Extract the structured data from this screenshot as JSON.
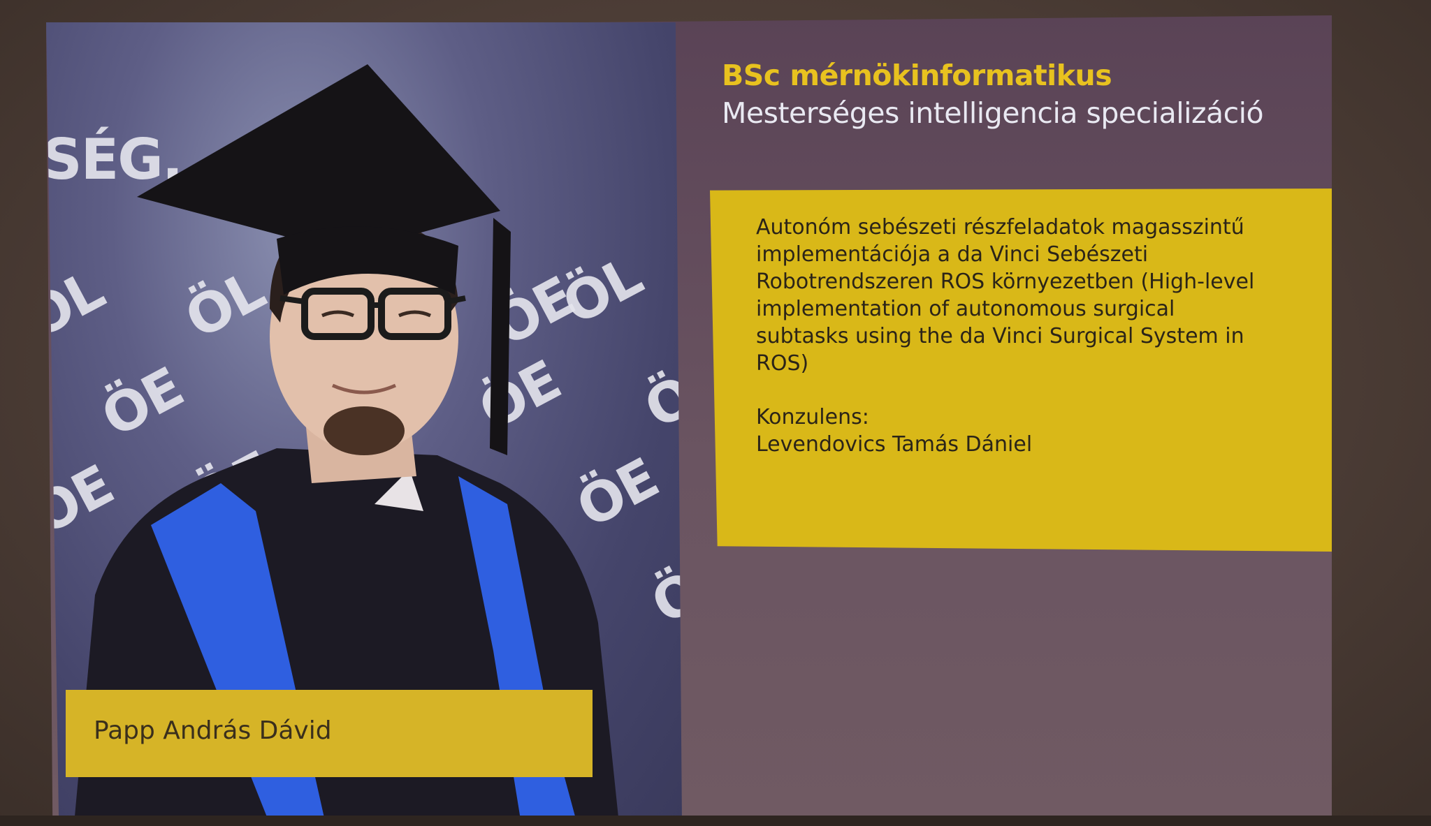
{
  "slide": {
    "degree": "BSc mérnökinformatikus",
    "specialization": "Mesterséges intelligencia specializáció",
    "thesis_title": "Autonóm sebészeti részfeladatok magasszintű\nimplementációja a da Vinci Sebészeti\nRobotrendszeren ROS környezetben (High-level\nimplementation of autonomous surgical\nsubtasks using the da Vinci Surgical System in\nROS)",
    "consultant_label": "Konzulens:",
    "consultant_name": "Levendovics Tamás Dániel",
    "student_name": "Papp András Dávid"
  },
  "backdrop": {
    "watermarks": [
      "SÉG.",
      "ÖL",
      "ÖL",
      "ÖE",
      "ÖE",
      "ÖE",
      "ÖE",
      "ÖE",
      "ÖE",
      "Ö",
      "Ö",
      "ÖL"
    ]
  },
  "colors": {
    "accent_yellow": "#d9b818",
    "title_yellow": "#e8c21f",
    "slide_purple": "#5a4356",
    "gown_blue": "#2f5fe0"
  }
}
